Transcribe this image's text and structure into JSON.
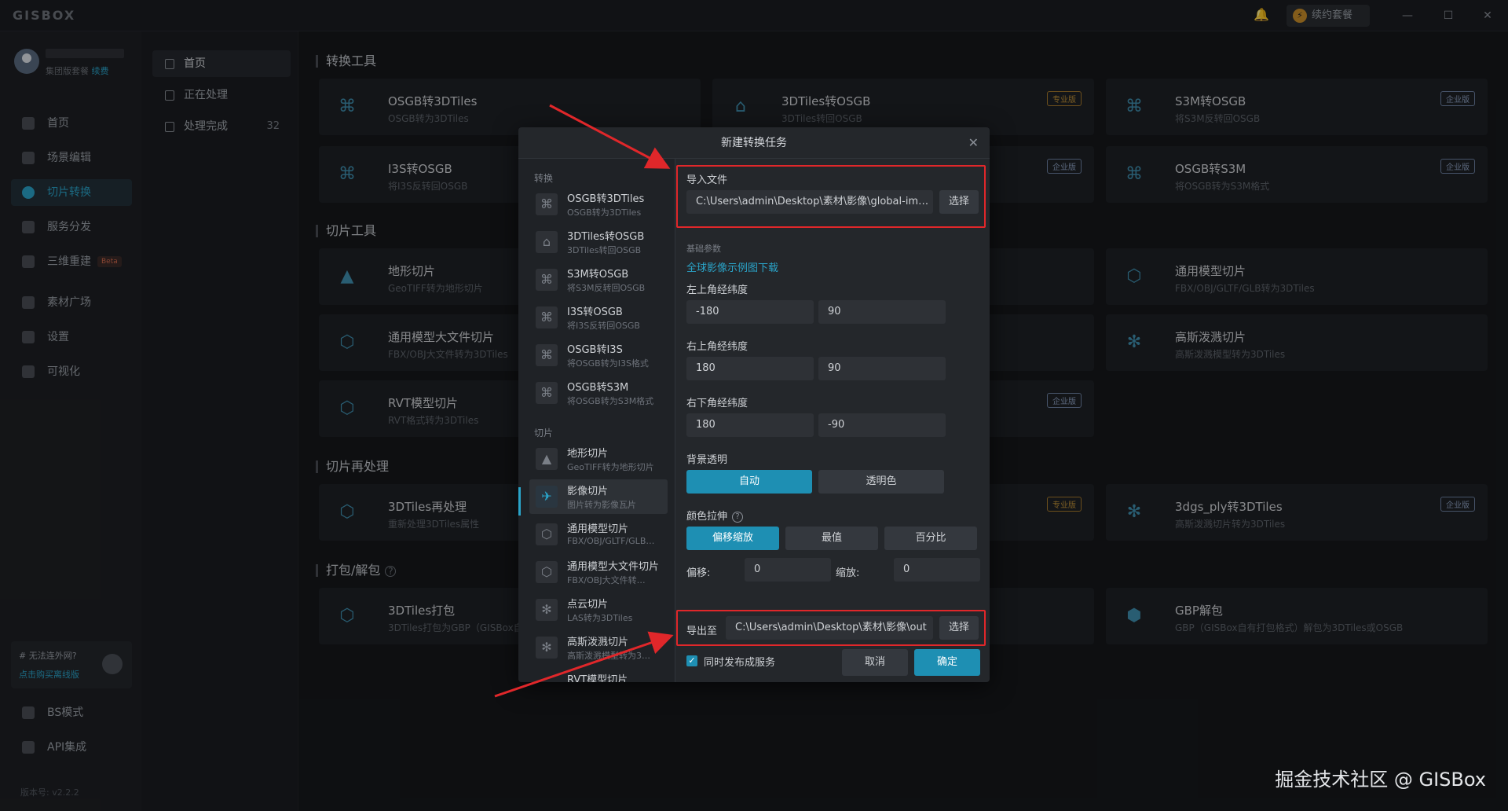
{
  "app": {
    "logo": "GISBOX",
    "plan_label": "续约套餐",
    "plan_icon": "lightning-icon"
  },
  "window": {
    "minimize": "—",
    "maximize": "☐",
    "close": "✕"
  },
  "user": {
    "sub_prefix": "集团版套餐",
    "sub_link": "续费"
  },
  "sidebar": {
    "items": [
      {
        "label": "首页"
      },
      {
        "label": "场景编辑"
      },
      {
        "label": "切片转换"
      },
      {
        "label": "服务分发"
      },
      {
        "label": "三维重建",
        "badge": "Beta"
      },
      {
        "label": "素材广场"
      },
      {
        "label": "设置"
      },
      {
        "label": "可视化"
      }
    ],
    "ad": {
      "title": "# 无法连外网?",
      "link": "点击购买离线版"
    },
    "bottom": [
      {
        "label": "BS模式"
      },
      {
        "label": "API集成"
      }
    ],
    "version": "版本号: v2.2.2"
  },
  "subnav": {
    "items": [
      {
        "label": "首页"
      },
      {
        "label": "正在处理"
      },
      {
        "label": "处理完成",
        "count": "32"
      }
    ]
  },
  "sections": {
    "convert": "转换工具",
    "slice": "切片工具",
    "reprocess": "切片再处理",
    "pack": "打包/解包"
  },
  "cards": {
    "c1": {
      "title": "OSGB转3DTiles",
      "sub": "OSGB转为3DTiles"
    },
    "c2": {
      "title": "3DTiles转OSGB",
      "sub": "3DTiles转回OSGB",
      "badge": "专业版"
    },
    "c3": {
      "title": "S3M转OSGB",
      "sub": "将S3M反转回OSGB",
      "badge": "企业版"
    },
    "c4": {
      "title": "I3S转OSGB",
      "sub": "将I3S反转回OSGB"
    },
    "c5": {
      "badge": "企业版"
    },
    "c6": {
      "title": "OSGB转S3M",
      "sub": "将OSGB转为S3M格式",
      "badge": "企业版"
    },
    "c7": {
      "title": "地形切片",
      "sub": "GeoTIFF转为地形切片"
    },
    "c8": {
      "title": "通用模型切片",
      "sub": "FBX/OBJ/GLTF/GLB转为3DTiles"
    },
    "c9": {
      "title": "通用模型大文件切片",
      "sub": "FBX/OBJ大文件转为3DTiles"
    },
    "c10": {
      "title": "高斯泼溅切片",
      "sub": "高斯泼溅模型转为3DTiles"
    },
    "c11": {
      "title": "RVT模型切片",
      "sub": "RVT格式转为3DTiles"
    },
    "c12": {
      "badge": "企业版"
    },
    "c13": {
      "title": "3DTiles再处理",
      "sub": "重新处理3DTiles属性"
    },
    "c14": {
      "badge": "专业版"
    },
    "c15": {
      "title": "3dgs_ply转3DTiles",
      "sub": "高斯泼溅切片转为3DTiles",
      "badge": "企业版"
    },
    "c16": {
      "title": "3DTiles打包",
      "sub": "3DTiles打包为GBP（GISBox自有打"
    },
    "c17": {
      "title": "GBP解包",
      "sub": "GBP（GISBox自有打包格式）解包为3DTiles或OSGB"
    }
  },
  "dialog": {
    "title": "新建转换任务",
    "close": "✕",
    "groups": {
      "convert": "转换",
      "slice": "切片"
    },
    "list": [
      {
        "title": "OSGB转3DTiles",
        "sub": "OSGB转为3DTiles"
      },
      {
        "title": "3DTiles转OSGB",
        "sub": "3DTiles转回OSGB"
      },
      {
        "title": "S3M转OSGB",
        "sub": "将S3M反转回OSGB"
      },
      {
        "title": "I3S转OSGB",
        "sub": "将I3S反转回OSGB"
      },
      {
        "title": "OSGB转I3S",
        "sub": "将OSGB转为I3S格式"
      },
      {
        "title": "OSGB转S3M",
        "sub": "将OSGB转为S3M格式"
      },
      {
        "title": "地形切片",
        "sub": "GeoTIFF转为地形切片"
      },
      {
        "title": "影像切片",
        "sub": "图片转为影像瓦片"
      },
      {
        "title": "通用模型切片",
        "sub": "FBX/OBJ/GLTF/GLB…"
      },
      {
        "title": "通用模型大文件切片",
        "sub": "FBX/OBJ大文件转…"
      },
      {
        "title": "点云切片",
        "sub": "LAS转为3DTiles"
      },
      {
        "title": "高斯泼溅切片",
        "sub": "高斯泼溅模型转为3…"
      },
      {
        "title": "RVT模型切片",
        "sub": ""
      }
    ],
    "form": {
      "import_label": "导入文件",
      "import_value": "C:\\Users\\admin\\Desktop\\素材\\影像\\global-ima…",
      "select": "选择",
      "basic_params": "基础参数",
      "sample_link": "全球影像示例图下载",
      "top_left": "左上角经纬度",
      "tl_lon": "-180",
      "tl_lat": "90",
      "top_right": "右上角经纬度",
      "tr_lon": "180",
      "tr_lat": "90",
      "bottom_right": "右下角经纬度",
      "br_lon": "180",
      "br_lat": "-90",
      "bg_transparent": "背景透明",
      "bg_auto": "自动",
      "bg_color": "透明色",
      "color_stretch": "颜色拉伸",
      "cs_offset": "偏移缩放",
      "cs_minmax": "最值",
      "cs_percent": "百分比",
      "offset_label": "偏移:",
      "offset_value": "0",
      "scale_label": "缩放:",
      "scale_value": "0",
      "export_label": "导出至",
      "export_value": "C:\\Users\\admin\\Desktop\\素材\\影像\\out",
      "publish": "同时发布成服务",
      "cancel": "取消",
      "confirm": "确定"
    }
  },
  "watermark": "掘金技术社区 @ GISBox",
  "colors": {
    "accent": "#1e8fb3",
    "highlight": "#e0272a",
    "pro_badge": "#c29238",
    "ent_badge": "#8ea2c3"
  }
}
